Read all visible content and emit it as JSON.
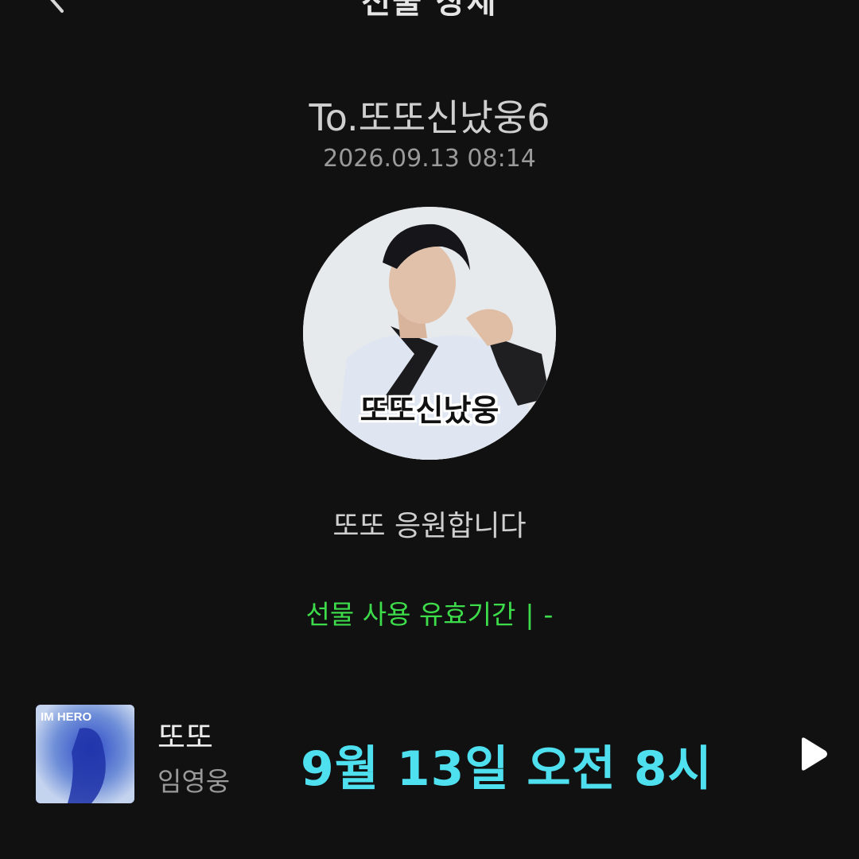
{
  "header": {
    "title": "선물 상세",
    "back_icon": "chevron-left-icon"
  },
  "gift": {
    "recipient": "To.또또신났웅6",
    "sent_at": "2026.09.13 08:14",
    "avatar_caption": "또또신났웅",
    "message": "또또 응원합니다",
    "validity_label": "선물 사용 유효기간",
    "validity_separator": "|",
    "validity_value": "-"
  },
  "track": {
    "title": "또또",
    "artist": "임영웅",
    "album_art_text": "IM HERO",
    "play_icon": "play-icon"
  },
  "overlay": {
    "note": "9월 13일 오전 8시"
  },
  "colors": {
    "background": "#111111",
    "validity_green": "#3ddc4a",
    "overlay_cyan": "#4fe0ef"
  }
}
